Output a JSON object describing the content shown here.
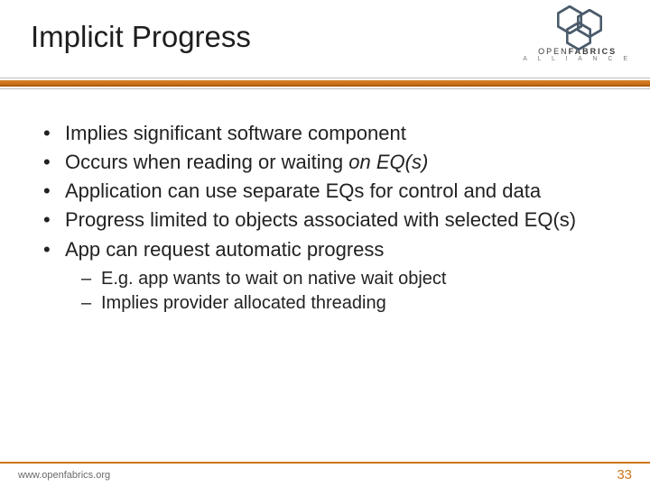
{
  "header": {
    "title": "Implicit Progress",
    "logo": {
      "brand_part1": "OPEN",
      "brand_part2": "FABRICS",
      "sub": "A L L I A N C E"
    }
  },
  "bullets": [
    {
      "pre": "Implies significant software component"
    },
    {
      "pre": "Occurs when reading or waiting ",
      "em": "on EQ(s)"
    },
    {
      "pre": "Application can use separate EQs for control and data"
    },
    {
      "pre": "Progress limited to objects associated with selected EQ(s)"
    },
    {
      "pre": "App can request automatic progress",
      "children": [
        "E.g. app wants to wait on native wait object",
        "Implies provider allocated threading"
      ]
    }
  ],
  "footer": {
    "url": "www.openfabrics.org",
    "page": "33"
  }
}
